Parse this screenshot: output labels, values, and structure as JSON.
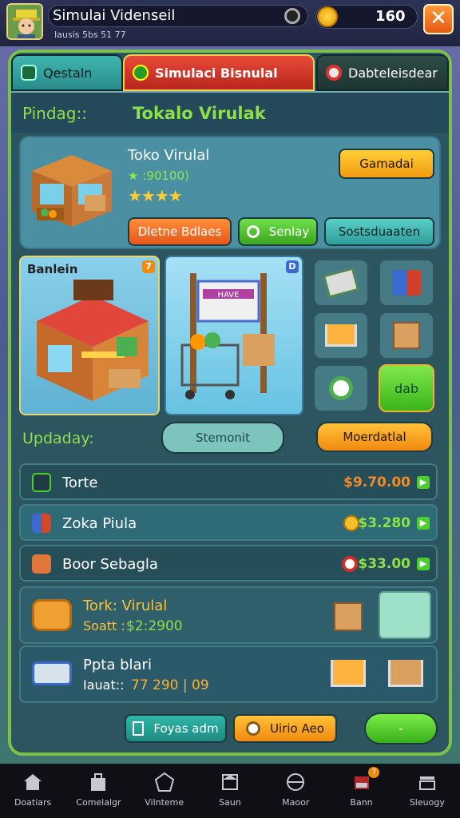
{
  "header": {
    "title": "Simulai Videnseil",
    "subtitle": "Iausis 5bs 51 77",
    "coins": "160",
    "close_label": "✕"
  },
  "tabs": [
    {
      "label": "Qestaln"
    },
    {
      "label": "Simulaci Bisnulal"
    },
    {
      "label": "Dabteleisdear"
    }
  ],
  "section": {
    "label": "Pindag::",
    "title": "Tokalo Virulak"
  },
  "shop_card": {
    "title": "Toko Virulal",
    "stat": "★ :90100)",
    "stars": "★★★★",
    "action": "Gamadai",
    "buttons": [
      "Dletne Bdlaes",
      "Senlay",
      "Sostsduaaten"
    ]
  },
  "gallery": {
    "image1_label": "Banlein",
    "badge1": "7",
    "badge2": "D",
    "grid_button_label": "dab",
    "store_sign": "HAVE"
  },
  "update": {
    "label": "Updaday:",
    "center_button": "Stemonit",
    "right_button": "Moerdatlal"
  },
  "rows": [
    {
      "label": "Torte",
      "value": "$9.70.00"
    },
    {
      "label": "Zoka Piula",
      "value": "$3.280"
    },
    {
      "label": "Boor Sebagla",
      "value": "$33.00"
    }
  ],
  "big_rows": [
    {
      "line1": "Tork: Virulal",
      "line2_label": "Soatt :",
      "line2_value": "$2:2900"
    },
    {
      "line1": "Ppta blari",
      "line2_label": "Iauat::",
      "line2_value": "77 290 | 09"
    }
  ],
  "bottom_buttons": [
    "Foyas adm",
    "Uirio Aeo",
    "-"
  ],
  "nav": [
    {
      "label": "Doatiars"
    },
    {
      "label": "Comelalgr"
    },
    {
      "label": "Vilnteme"
    },
    {
      "label": "Saun"
    },
    {
      "label": "Maoor"
    },
    {
      "label": "Bann"
    },
    {
      "label": "Sleuogy"
    }
  ],
  "nav_badge": "7",
  "colors": {
    "accent_green": "#8ee04a",
    "panel": "#2c5560",
    "orange": "#f29a10",
    "red_tab": "#e84a3a"
  }
}
